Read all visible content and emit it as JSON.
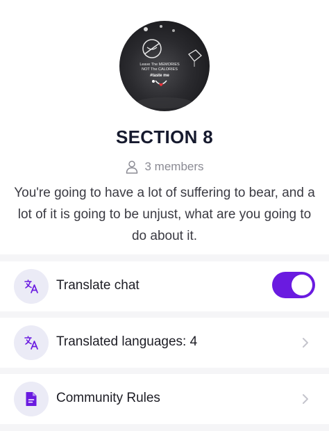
{
  "group": {
    "name": "SECTION 8",
    "members": "3 members",
    "description": "You're going to have a lot of suffering to bear, and a lot of it is going to be unjust, what are you going to do about it.",
    "avatar_text": [
      "Leave The MEMORIES",
      "NOT The CALORIES",
      "#taste me"
    ]
  },
  "settings": [
    {
      "label": "Translate chat",
      "icon": "translate-icon",
      "toggle_on": true
    },
    {
      "label": "Translated languages: 4",
      "icon": "translate-icon"
    },
    {
      "label": "Community Rules",
      "icon": "document-icon"
    }
  ],
  "colors": {
    "accent": "#6a1be0",
    "icon_bg": "#ebebf6",
    "title": "#161a2e",
    "muted": "#8b8b94"
  }
}
